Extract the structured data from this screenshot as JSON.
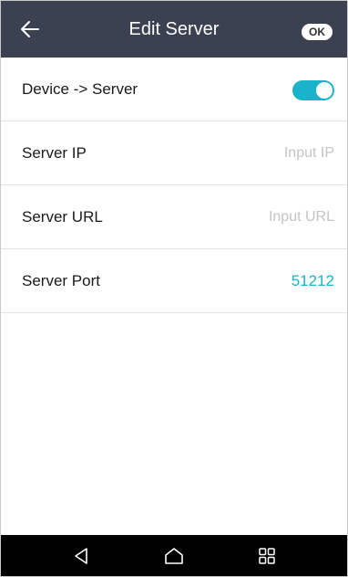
{
  "header": {
    "title": "Edit Server",
    "ok_label": "OK"
  },
  "settings": {
    "device_to_server": {
      "label": "Device -> Server",
      "enabled": true
    },
    "server_ip": {
      "label": "Server IP",
      "placeholder": "Input IP",
      "value": ""
    },
    "server_url": {
      "label": "Server URL",
      "placeholder": "Input URL",
      "value": ""
    },
    "server_port": {
      "label": "Server Port",
      "value": "51212"
    }
  },
  "colors": {
    "header_bg": "#3b4150",
    "accent": "#1ab3c9",
    "placeholder": "#c4c4c4",
    "navbar_bg": "#000000"
  },
  "icons": {
    "back": "arrow-left-icon",
    "nav_back": "triangle-back-icon",
    "nav_home": "home-icon",
    "nav_apps": "grid-icon"
  }
}
